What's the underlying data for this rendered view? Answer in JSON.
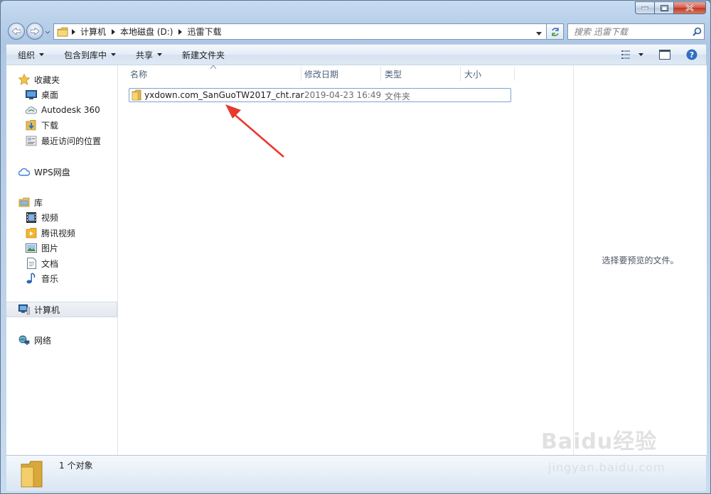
{
  "window": {
    "caption_buttons": [
      "minimize",
      "maximize",
      "close"
    ]
  },
  "address": {
    "crumbs": [
      "计算机",
      "本地磁盘 (D:)",
      "迅雷下载"
    ]
  },
  "search": {
    "placeholder": "搜索 迅雷下载"
  },
  "toolbar": {
    "organize": "组织",
    "include_in_library": "包含到库中",
    "share": "共享",
    "new_folder": "新建文件夹"
  },
  "nav": {
    "favorites": "收藏夹",
    "desktop": "桌面",
    "autodesk": "Autodesk 360",
    "downloads": "下载",
    "recent": "最近访问的位置",
    "wps": "WPS网盘",
    "libraries": "库",
    "videos": "视频",
    "tencent_video": "腾讯视频",
    "pictures": "图片",
    "documents": "文档",
    "music": "音乐",
    "computer": "计算机",
    "network": "网络"
  },
  "columns": {
    "name": "名称",
    "modified": "修改日期",
    "type": "类型",
    "size": "大小"
  },
  "files": [
    {
      "name": "yxdown.com_SanGuoTW2017_cht.rar",
      "modified": "2019-04-23 16:49",
      "type": "文件夹",
      "size": ""
    }
  ],
  "preview": {
    "message": "选择要预览的文件。"
  },
  "details": {
    "count": "1 个对象"
  },
  "watermark": {
    "brand": "Baidu经验",
    "url": "jingyan.baidu.com"
  },
  "colors": {
    "annotation_arrow": "#e8392f",
    "selection_border": "#7da2ce"
  }
}
